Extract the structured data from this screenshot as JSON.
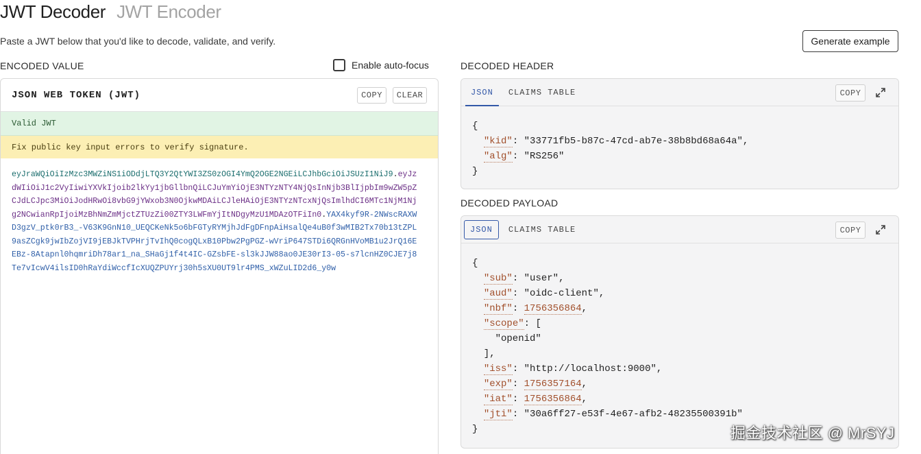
{
  "header": {
    "tabs": [
      {
        "label": "JWT Decoder",
        "active": true
      },
      {
        "label": "JWT Encoder",
        "active": false
      }
    ],
    "subtitle": "Paste a JWT below that you'd like to decode, validate, and verify.",
    "generate_label": "Generate example"
  },
  "encoded": {
    "section_label": "ENCODED VALUE",
    "autofocus_label": "Enable auto-focus",
    "autofocus_checked": false,
    "panel_title": "JSON WEB TOKEN (JWT)",
    "copy_label": "COPY",
    "clear_label": "CLEAR",
    "status_valid": "Valid JWT",
    "status_warning": "Fix public key input errors to verify signature.",
    "token_header": "eyJraWQiOiIzMzc3MWZiNS1iODdjLTQ3Y2QtYWI3ZS0zOGI4YmQ2OGE2NGEiLCJhbGciOiJSUzI1NiJ9",
    "token_payload": "eyJzdWIiOiJ1c2VyIiwiYXVkIjoib2lkYy1jbGllbnQiLCJuYmYiOjE3NTYzNTY4NjQsInNjb3BlIjpbIm9wZW5pZCJdLCJpc3MiOiJodHRwOi8vbG9jYWxob3N0OjkwMDAiLCJleHAiOjE3NTYzNTcxNjQsImlhdCI6MTc1NjM1Njg2NCwianRpIjoiMzBhNmZmMjctZTUzZi00ZTY3LWFmYjItNDgyMzU1MDAzOTFiIn0",
    "token_signature": "YAX4kyf9R-2NWscRAXWD3gzV_ptk0rB3_-V63K9GnN10_UEQCKeNk5o6bFGTyRYMjhJdFgDFnpAiHsalQe4uB0f3wMIB2Tx70b13tZPL9asZCgk9jwIbZojVI9jEBJkTVPHrjTvIhQ0cogQLxB10Pbw2PgPGZ-wVriP647STDi6QRGnHVoMB1u2JrQ16EEBz-8Atapnl0hqmriDh78ar1_na_SHaGj1f4t4IC-GZsbFE-sl3kJJW88ao0JE30rI3-05-s7lcnHZ0CJE7j8Te7vIcwV4ilsID0hRaYdiWccfIcXUQZPUYrj30h5sXU0UT9lr4PMS_xWZuLID2d6_y0w"
  },
  "decoded_header": {
    "section_label": "DECODED HEADER",
    "tabs": [
      "JSON",
      "CLAIMS TABLE"
    ],
    "copy_label": "COPY",
    "lines": [
      {
        "t": "open"
      },
      {
        "key": "kid",
        "val": "\"33771fb5-b87c-47cd-ab7e-38b8bd68a64a\"",
        "type": "s",
        "comma": true
      },
      {
        "key": "alg",
        "val": "\"RS256\"",
        "type": "s",
        "comma": false
      },
      {
        "t": "close"
      }
    ]
  },
  "decoded_payload": {
    "section_label": "DECODED PAYLOAD",
    "tabs": [
      "JSON",
      "CLAIMS TABLE"
    ],
    "copy_label": "COPY",
    "lines": [
      {
        "t": "open"
      },
      {
        "key": "sub",
        "val": "\"user\"",
        "type": "s",
        "comma": true
      },
      {
        "key": "aud",
        "val": "\"oidc-client\"",
        "type": "s",
        "comma": true
      },
      {
        "key": "nbf",
        "val": "1756356864",
        "type": "n",
        "comma": true
      },
      {
        "key": "scope",
        "val": "[",
        "type": "s",
        "comma": false
      },
      {
        "raw": "    \"openid\""
      },
      {
        "raw": "  ],"
      },
      {
        "key": "iss",
        "val": "\"http://localhost:9000\"",
        "type": "s",
        "comma": true
      },
      {
        "key": "exp",
        "val": "1756357164",
        "type": "n",
        "comma": true
      },
      {
        "key": "iat",
        "val": "1756356864",
        "type": "n",
        "comma": true
      },
      {
        "key": "jti",
        "val": "\"30a6ff27-e53f-4e67-afb2-48235500391b\"",
        "type": "s",
        "comma": false
      },
      {
        "t": "close"
      }
    ]
  },
  "watermark": "掘金技术社区 @ MrSYJ",
  "colors": {
    "valid_bg": "#e1f4e4",
    "warning_bg": "#fcefb4",
    "active_tab": "#3358a8",
    "key_color": "#a14f2b"
  }
}
